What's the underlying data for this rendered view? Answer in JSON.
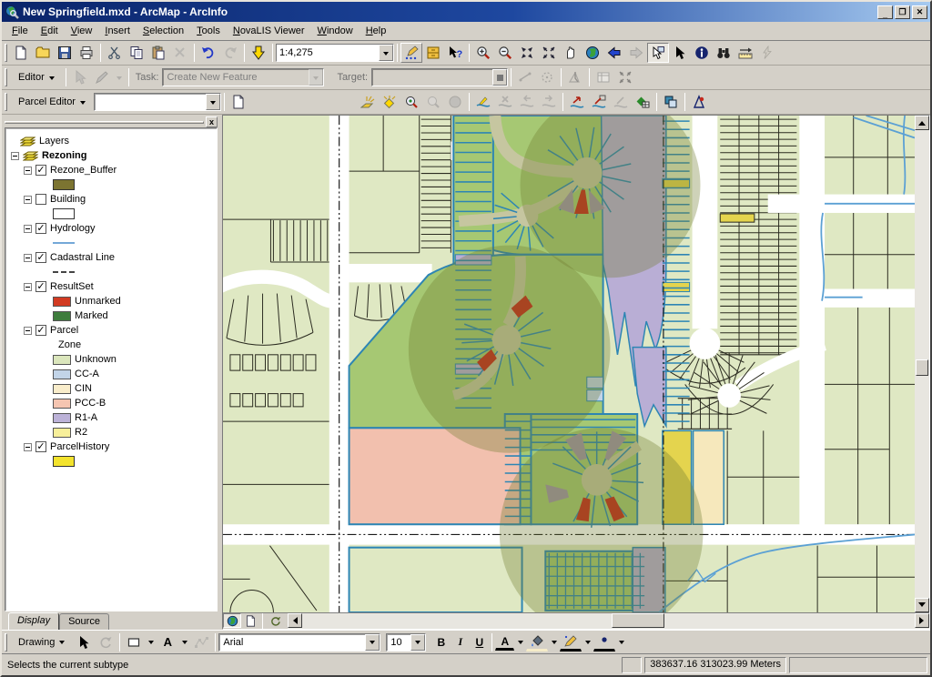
{
  "window": {
    "title": "New Springfield.mxd - ArcMap - ArcInfo"
  },
  "menu": {
    "items": [
      "File",
      "Edit",
      "View",
      "Insert",
      "Selection",
      "Tools",
      "NovaLIS Viewer",
      "Window",
      "Help"
    ]
  },
  "standard_toolbar": {
    "scale": "1:4,275"
  },
  "editor_toolbar": {
    "editor_label": "Editor",
    "task_label": "Task:",
    "task_value": "Create New Feature",
    "target_label": "Target:",
    "target_value": ""
  },
  "parcel_toolbar": {
    "label": "Parcel Editor",
    "combo_value": ""
  },
  "toc": {
    "rows": [
      {
        "t": "root",
        "label": "Layers"
      },
      {
        "t": "group",
        "label": "Rezoning"
      },
      {
        "t": "layer",
        "label": "Rezone_Buffer",
        "checked": true
      },
      {
        "t": "sfill",
        "color": "#7c7431"
      },
      {
        "t": "layer",
        "label": "Building",
        "checked": false
      },
      {
        "t": "sfill",
        "color": "#ffffff"
      },
      {
        "t": "layer",
        "label": "Hydrology",
        "checked": true
      },
      {
        "t": "sline",
        "color": "#74a8d8"
      },
      {
        "t": "layer",
        "label": "Cadastral Line",
        "checked": true
      },
      {
        "t": "sdash",
        "color": "#444444"
      },
      {
        "t": "layer",
        "label": "ResultSet",
        "checked": true
      },
      {
        "t": "class",
        "label": "Unmarked",
        "color": "#d23b22"
      },
      {
        "t": "class",
        "label": "Marked",
        "color": "#3e7d3d"
      },
      {
        "t": "layer",
        "label": "Parcel",
        "checked": true
      },
      {
        "t": "field",
        "label": "Zone"
      },
      {
        "t": "class",
        "label": "Unknown",
        "color": "#dbe6bc"
      },
      {
        "t": "class",
        "label": "CC-A",
        "color": "#c2d4e8"
      },
      {
        "t": "class",
        "label": "CIN",
        "color": "#f9edcb"
      },
      {
        "t": "class",
        "label": "PCC-B",
        "color": "#f5c5b1"
      },
      {
        "t": "class",
        "label": "R1-A",
        "color": "#bcb2d8"
      },
      {
        "t": "class",
        "label": "R2",
        "color": "#f7ef9a"
      },
      {
        "t": "layer",
        "label": "ParcelHistory",
        "checked": true
      },
      {
        "t": "sfill",
        "color": "#f3e32d"
      }
    ],
    "tabs": [
      {
        "label": "Display"
      },
      {
        "label": "Source"
      }
    ]
  },
  "drawing_toolbar": {
    "label": "Drawing",
    "font": "Arial",
    "size": "10",
    "bold": "B",
    "italic": "I",
    "underline": "U",
    "color_glyph": "A"
  },
  "status_bar": {
    "message": "Selects the current subtype",
    "coords": "383637.16  313023.99 Meters"
  },
  "map": {
    "colors": {
      "parcel_unknown": "#dfe8c3",
      "subdivision_green": "#a6c873",
      "street_tan": "#c6c6a0",
      "selection_blue": "#2d85b4",
      "zone_r1a": "#b9aed5",
      "zone_pccb": "#f2c0ae",
      "zone_cin": "#f6e8bc",
      "zone_r2": "#e4d44e",
      "zone_cca": "#c2d4e8",
      "marked_red": "#c6281b",
      "buffer_olive": "#6e7c30",
      "hydrology_blue": "#5ba0d4",
      "road_white": "#ffffff",
      "parcel_line": "#2b2b20"
    }
  }
}
